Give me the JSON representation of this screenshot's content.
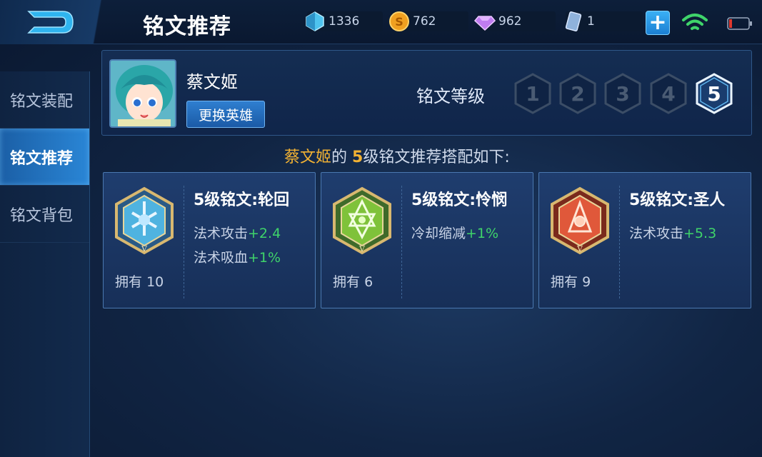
{
  "header": {
    "title": "铭文推荐",
    "resources": [
      {
        "name": "diamond",
        "value": "1336",
        "icon": "crystal-icon",
        "color": "#5ac8f0"
      },
      {
        "name": "gold",
        "value": "762",
        "icon": "gold-coin-icon",
        "color": "#f0a020"
      },
      {
        "name": "gem",
        "value": "962",
        "icon": "purple-gem-icon",
        "color": "#c07cf0"
      },
      {
        "name": "card",
        "value": "1",
        "icon": "card-icon",
        "color": "#a8c4e8"
      }
    ],
    "accent": "#2a86d6"
  },
  "sidebar": {
    "items": [
      {
        "label": "铭文装配",
        "active": false
      },
      {
        "label": "铭文推荐",
        "active": true
      },
      {
        "label": "铭文背包",
        "active": false
      }
    ]
  },
  "hero": {
    "name": "蔡文姬",
    "change_label": "更换英雄",
    "level_label": "铭文等级",
    "levels": [
      "1",
      "2",
      "3",
      "4",
      "5"
    ],
    "selected_level": "5"
  },
  "recommendation": {
    "hero": "蔡文姬",
    "of": "的",
    "level": "5",
    "suffix": "级铭文推荐搭配如下:"
  },
  "cards": [
    {
      "title": "5级铭文:轮回",
      "color": "#4fb3e0",
      "stats": [
        {
          "name": "法术攻击",
          "bonus": "+2.4"
        },
        {
          "name": "法术吸血",
          "bonus": "+1%"
        }
      ],
      "own_label": "拥有",
      "own_count": "10"
    },
    {
      "title": "5级铭文:怜悯",
      "color": "#7fc23a",
      "stats": [
        {
          "name": "冷却缩减",
          "bonus": "+1%"
        }
      ],
      "own_label": "拥有",
      "own_count": "6"
    },
    {
      "title": "5级铭文:圣人",
      "color": "#e0583a",
      "stats": [
        {
          "name": "法术攻击",
          "bonus": "+5.3"
        }
      ],
      "own_label": "拥有",
      "own_count": "9"
    }
  ]
}
